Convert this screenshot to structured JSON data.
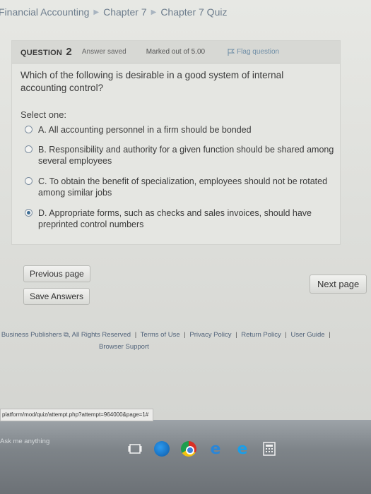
{
  "breadcrumb": {
    "items": [
      "Financial Accounting",
      "Chapter 7",
      "Chapter 7 Quiz"
    ]
  },
  "question": {
    "label": "QUESTION",
    "number": "2",
    "status": "Answer saved",
    "marks": "Marked out of 5.00",
    "flag_label": "Flag question",
    "text": "Which of the following is desirable in a good system of internal accounting control?",
    "select_one": "Select one:",
    "options": [
      {
        "label": "A. All accounting personnel in a firm should be bonded",
        "checked": false
      },
      {
        "label": "B. Responsibility and authority for a given function should be shared among several employees",
        "checked": false
      },
      {
        "label": "C. To obtain the benefit of specialization, employees should not be rotated among similar jobs",
        "checked": false
      },
      {
        "label": "D. Appropriate forms, such as checks and sales invoices, should have preprinted control numbers",
        "checked": true
      }
    ]
  },
  "nav": {
    "previous_label": "Previous page",
    "save_label": "Save Answers",
    "next_label": "Next page"
  },
  "footer": {
    "publisher": "e Business Publishers",
    "rights": "All Rights Reserved",
    "links": [
      "Terms of Use",
      "Privacy Policy",
      "Return Policy",
      "User Guide"
    ],
    "support": "Browser Support"
  },
  "status_bar": {
    "url": "platform/mod/quiz/attempt.php?attempt=964000&page=1#"
  },
  "taskbar": {
    "search_placeholder": "Ask me anything"
  },
  "colors": {
    "link": "#51637a",
    "radio_checked": "#3f6f96",
    "flag": "#6f8ea6"
  }
}
